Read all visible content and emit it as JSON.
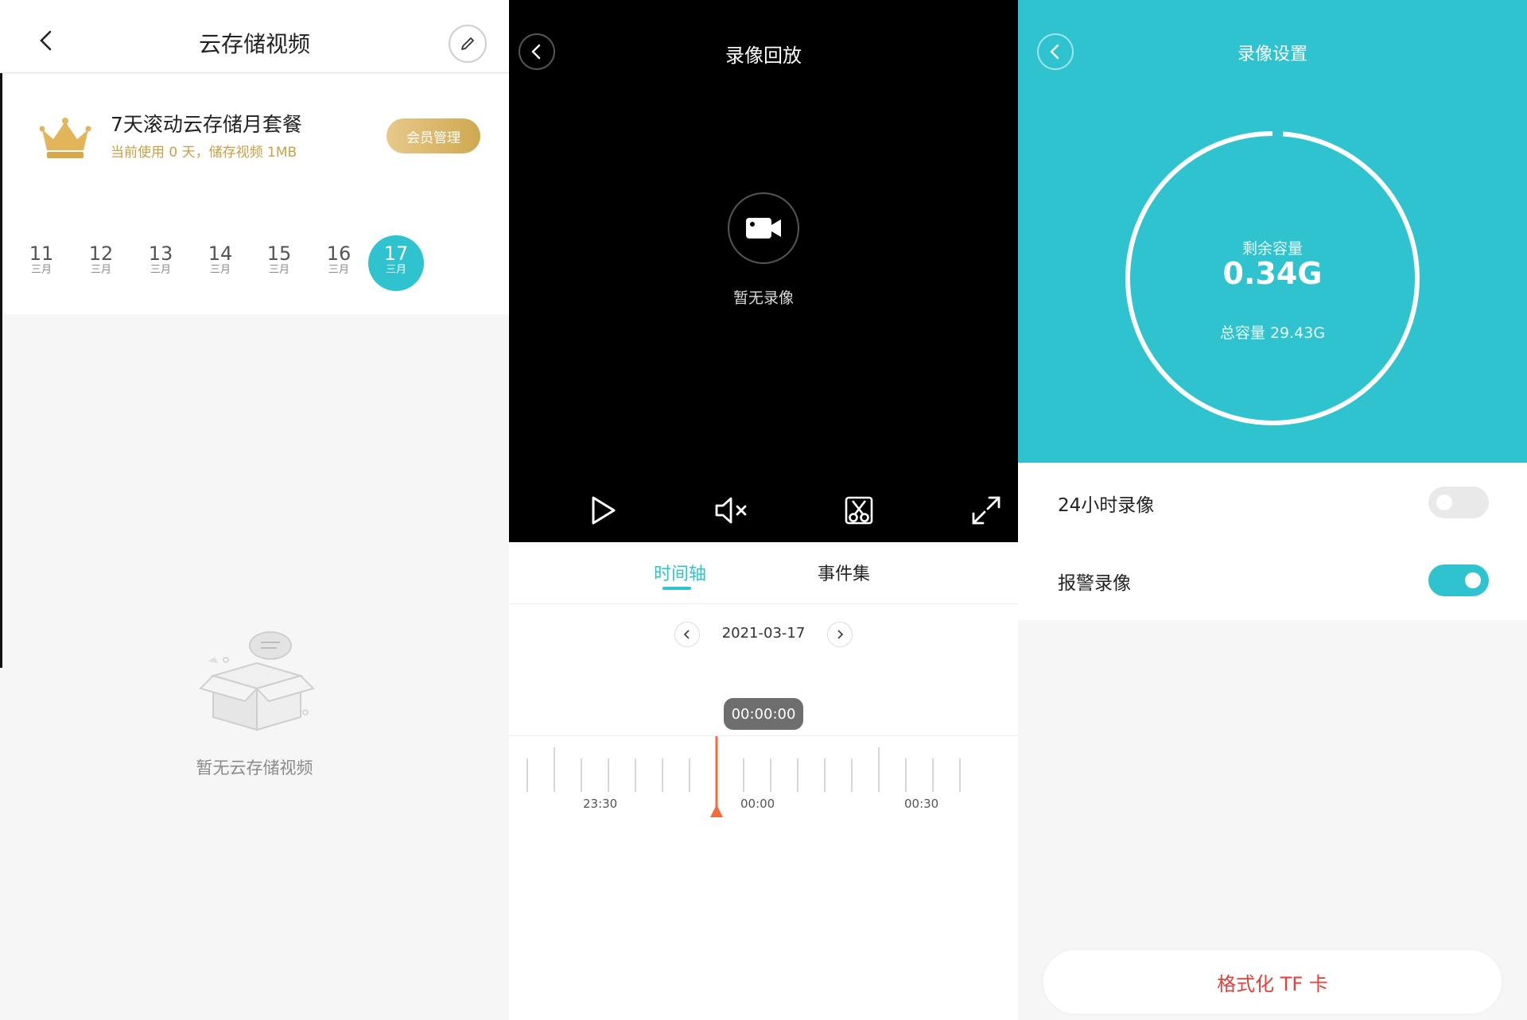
{
  "cloud": {
    "title": "云存储视频",
    "plan_title": "7天滚动云存储月套餐",
    "plan_subtitle": "当前使用 0 天，储存视频 1MB",
    "member_button": "会员管理",
    "dates": [
      {
        "day": "11",
        "month": "三月",
        "selected": false
      },
      {
        "day": "12",
        "month": "三月",
        "selected": false
      },
      {
        "day": "13",
        "month": "三月",
        "selected": false
      },
      {
        "day": "14",
        "month": "三月",
        "selected": false
      },
      {
        "day": "15",
        "month": "三月",
        "selected": false
      },
      {
        "day": "16",
        "month": "三月",
        "selected": false
      },
      {
        "day": "17",
        "month": "三月",
        "selected": true
      }
    ],
    "empty_text": "暂无云存储视频",
    "icons": {
      "back": "chevron-left-icon",
      "edit": "pencil-icon",
      "crown": "crown-icon",
      "empty": "empty-box-icon"
    }
  },
  "playback": {
    "title": "录像回放",
    "no_recording": "暂无录像",
    "controls": [
      "play-icon",
      "mute-icon",
      "screenshot-scissors-icon",
      "fullscreen-icon"
    ],
    "tabs": {
      "timeline": "时间轴",
      "events": "事件集"
    },
    "date": "2021-03-17",
    "current_time": "00:00:00",
    "timeline_labels": [
      "23:30",
      "00:00",
      "00:30"
    ]
  },
  "settings": {
    "title": "录像设置",
    "remaining_label": "剩余容量",
    "remaining_value": "0.34G",
    "total_label": "总容量 29.43G",
    "remaining_fraction": 0.0116,
    "rows": [
      {
        "label": "24小时录像",
        "on": false
      },
      {
        "label": "报警录像",
        "on": true
      }
    ],
    "format_button": "格式化 TF 卡"
  },
  "colors": {
    "accent": "#2ec3cf",
    "gold": "#c9a046",
    "danger": "#e0413a",
    "playhead": "#f26b3a"
  }
}
